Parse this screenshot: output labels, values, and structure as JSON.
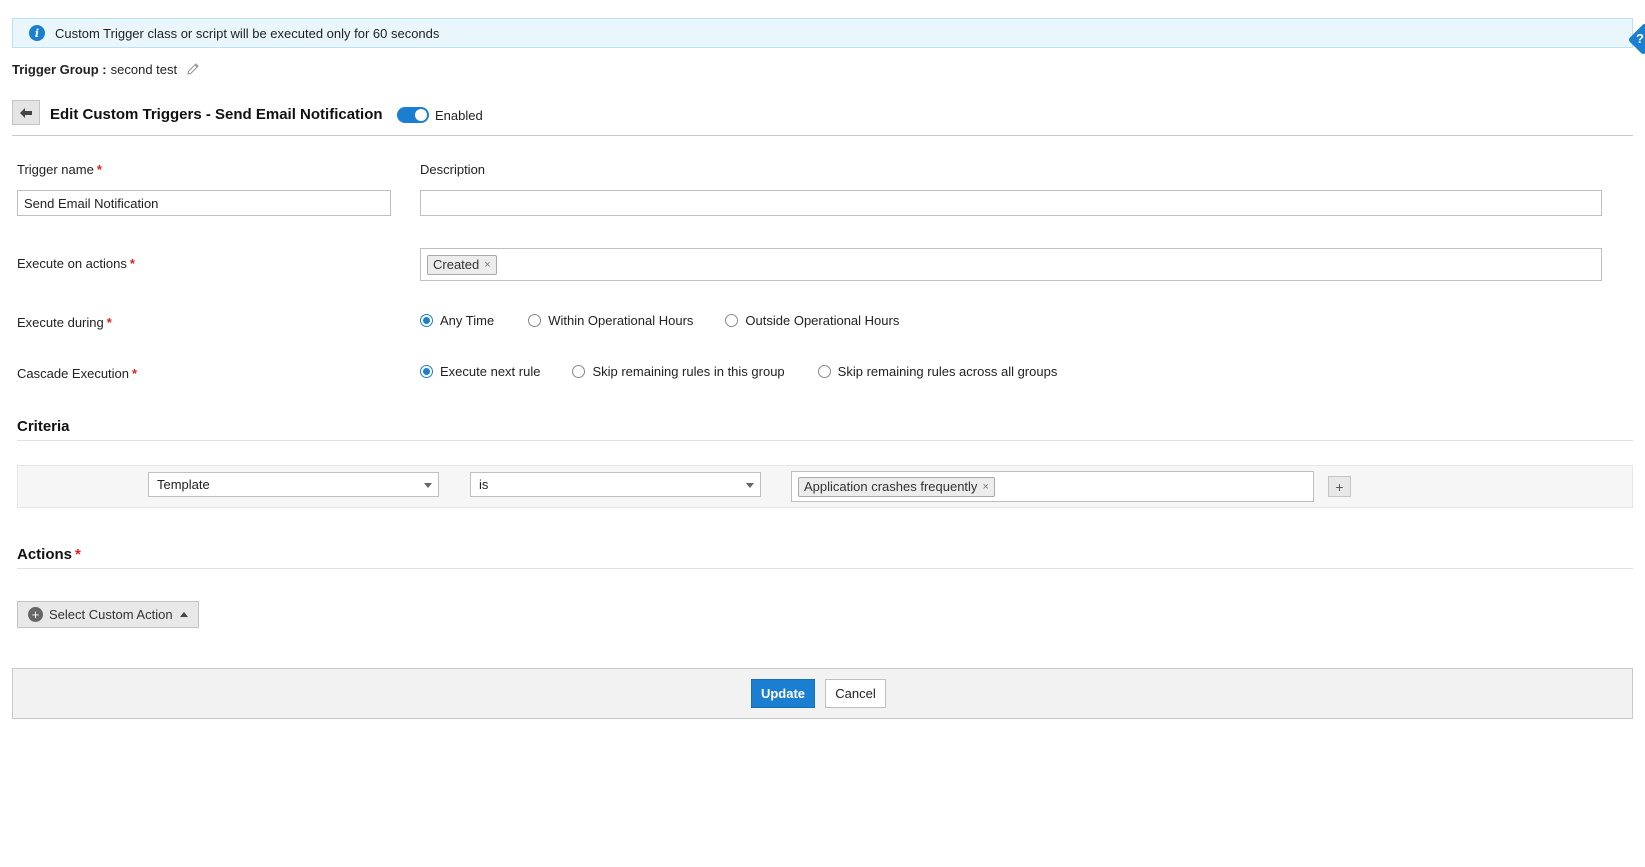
{
  "info_banner": {
    "text": "Custom Trigger class or script will be executed only for 60 seconds",
    "icon": "info-icon"
  },
  "help": {
    "icon": "help-icon",
    "label": "?"
  },
  "trigger_group": {
    "label": "Trigger Group :",
    "value": "second test",
    "edit_icon": "pencil-icon"
  },
  "header": {
    "back_icon": "back-arrow-icon",
    "title": "Edit Custom Triggers - Send Email Notification",
    "toggle_state": "on",
    "toggle_label": "Enabled"
  },
  "form": {
    "trigger_name": {
      "label": "Trigger name",
      "required_mark": "*",
      "value": "Send Email Notification"
    },
    "description": {
      "label": "Description",
      "value": ""
    },
    "execute_on_actions": {
      "label": "Execute on actions",
      "required_mark": "*",
      "tags": [
        "Created"
      ],
      "remove_symbol": "×"
    },
    "execute_during": {
      "label": "Execute during",
      "required_mark": "*",
      "options": [
        "Any Time",
        "Within Operational Hours",
        "Outside Operational Hours"
      ],
      "selected": "Any Time"
    },
    "cascade_execution": {
      "label": "Cascade Execution",
      "required_mark": "*",
      "options": [
        "Execute next rule",
        "Skip remaining rules in this group",
        "Skip remaining rules across all groups"
      ],
      "selected": "Execute next rule"
    }
  },
  "criteria": {
    "title": "Criteria",
    "field_select": "Template",
    "operator_select": "is",
    "value_tags": [
      "Application crashes frequently"
    ],
    "remove_symbol": "×",
    "add_label": "+"
  },
  "actions": {
    "title": "Actions",
    "required_mark": "*",
    "select_label": "Select Custom Action",
    "plus_symbol": "+"
  },
  "footer": {
    "update_label": "Update",
    "cancel_label": "Cancel"
  },
  "colors": {
    "accent": "#1a7fd0",
    "required": "#e02020",
    "info_bg": "#e9f7fd",
    "footer_bg": "#f2f2f2"
  }
}
